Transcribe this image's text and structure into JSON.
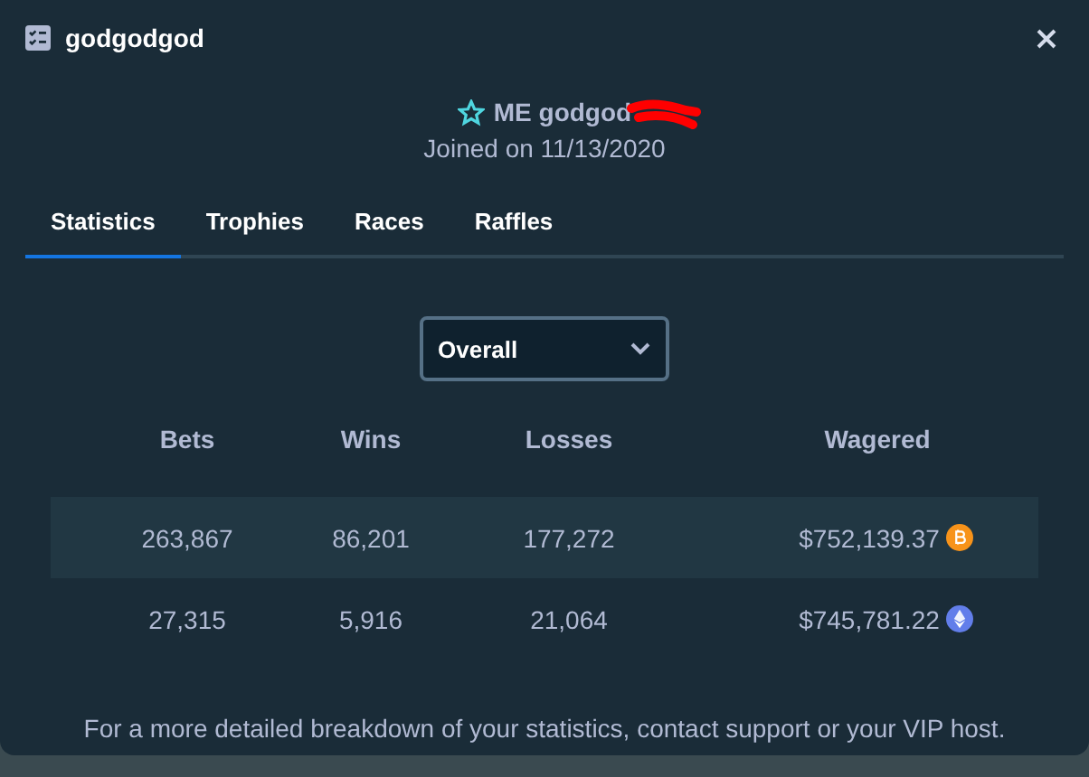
{
  "window": {
    "title": "godgodgod"
  },
  "profile": {
    "name": "ME godgod",
    "joined": "Joined on 11/13/2020"
  },
  "tabs": [
    {
      "label": "Statistics",
      "selected": true
    },
    {
      "label": "Trophies",
      "selected": false
    },
    {
      "label": "Races",
      "selected": false
    },
    {
      "label": "Raffles",
      "selected": false
    }
  ],
  "period_select": {
    "value": "Overall"
  },
  "table": {
    "columns": [
      "Bets",
      "Wins",
      "Losses",
      "Wagered"
    ],
    "rows": [
      {
        "cells": [
          "263,867",
          "86,201",
          "177,272",
          "$752,139.37"
        ],
        "kind": "btc"
      },
      {
        "cells": [
          "27,315",
          "5,916",
          "21,064",
          "$745,781.22"
        ],
        "kind": "eth"
      }
    ]
  },
  "footer_note": "For a more detailed breakdown of your statistics, contact support or your VIP host."
}
